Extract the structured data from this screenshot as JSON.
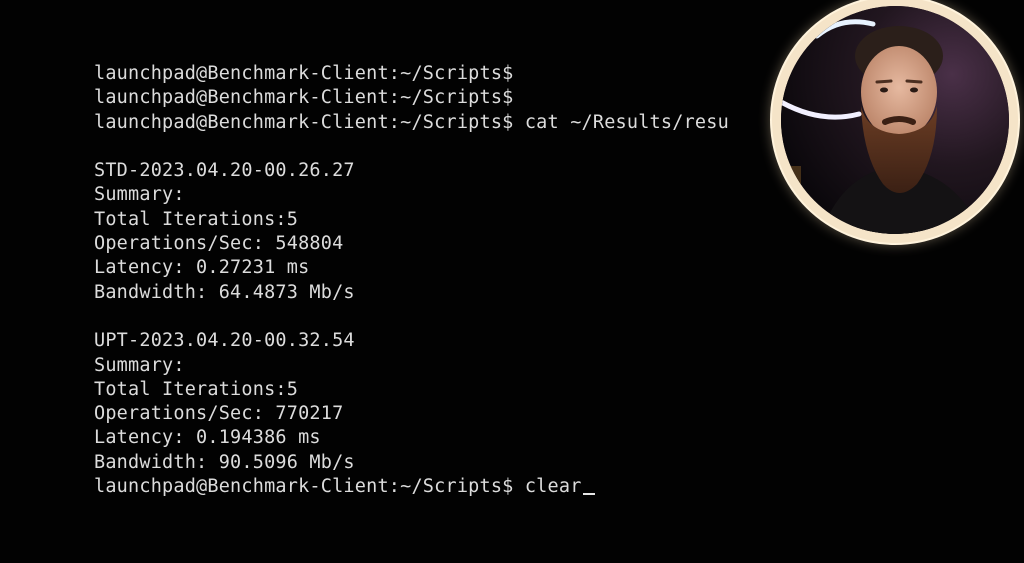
{
  "terminal": {
    "lines": [
      "launchpad@Benchmark-Client:~/Scripts$",
      "launchpad@Benchmark-Client:~/Scripts$",
      "launchpad@Benchmark-Client:~/Scripts$ cat ~/Results/resu",
      "",
      "STD-2023.04.20-00.26.27",
      "Summary:",
      "Total Iterations:5",
      "Operations/Sec: 548804",
      "Latency: 0.27231 ms",
      "Bandwidth: 64.4873 Mb/s",
      "",
      "UPT-2023.04.20-00.32.54",
      "Summary:",
      "Total Iterations:5",
      "Operations/Sec: 770217",
      "Latency: 0.194386 ms",
      "Bandwidth: 90.5096 Mb/s"
    ],
    "current_prompt": "launchpad@Benchmark-Client:~/Scripts$ clear"
  },
  "colors": {
    "background": "#020202",
    "text": "#dcdcdc",
    "webcam_ring": "#f5e4c8"
  }
}
